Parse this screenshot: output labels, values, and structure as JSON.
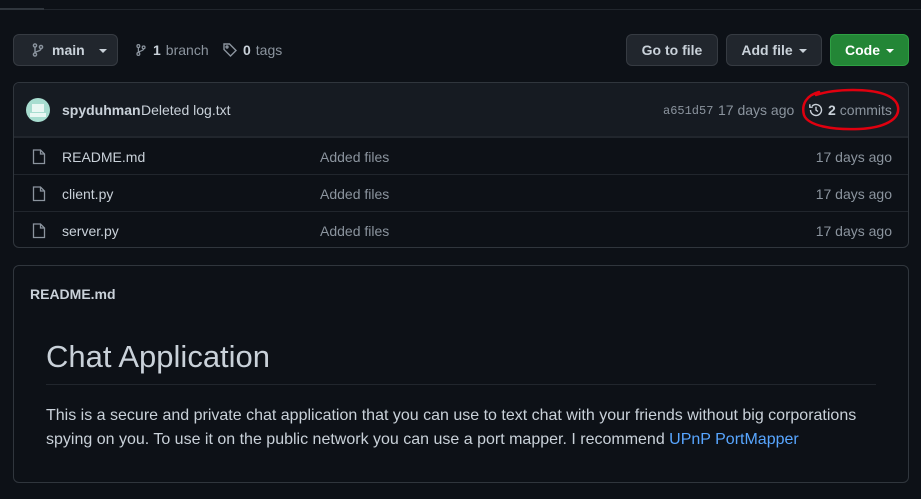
{
  "toolbar": {
    "branch_name": "main",
    "branch_count": "1",
    "branch_label": "branch",
    "tag_count": "0",
    "tag_label": "tags",
    "go_to_file": "Go to file",
    "add_file": "Add file",
    "code": "Code"
  },
  "latest_commit": {
    "author": "spyduhman",
    "message": "Deleted log.txt",
    "sha": "a651d57",
    "age": "17 days ago",
    "commit_count": "2",
    "commit_label": "commits"
  },
  "files": [
    {
      "name": "README.md",
      "message": "Added files",
      "age": "17 days ago"
    },
    {
      "name": "client.py",
      "message": "Added files",
      "age": "17 days ago"
    },
    {
      "name": "server.py",
      "message": "Added files",
      "age": "17 days ago"
    }
  ],
  "readme": {
    "filename": "README.md",
    "title": "Chat Application",
    "body_text": "This is a secure and private chat application that you can use to text chat with your friends without big corporations spying on you. To use it on the public network you can use a port mapper. I recommend ",
    "link_text": "UPnP PortMapper"
  },
  "colors": {
    "background": "#0d1117",
    "code_button": "#238636",
    "link": "#58a6ff",
    "annotation": "#e0000f"
  },
  "icons": [
    "git-branch-icon",
    "tag-icon",
    "history-icon",
    "file-icon"
  ]
}
